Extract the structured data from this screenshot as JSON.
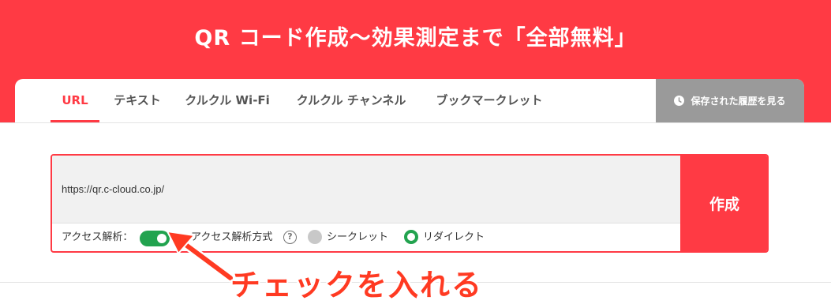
{
  "hero": {
    "title": "QR コード作成〜効果測定まで「全部無料」"
  },
  "tabs": [
    {
      "label": "URL",
      "active": true
    },
    {
      "label": "テキスト",
      "active": false
    },
    {
      "label": "クルクル Wi-Fi",
      "active": false
    },
    {
      "label": "クルクル チャンネル",
      "active": false
    },
    {
      "label": "ブックマークレット",
      "active": false
    }
  ],
  "history": {
    "label": "保存された履歴を見る",
    "icon": "clock-icon"
  },
  "form": {
    "url_value": "https://qr.c-cloud.co.jp/",
    "create_label": "作成",
    "access_analysis_label": "アクセス解析：",
    "access_analysis_enabled": true,
    "method_label": "アクセス解析方式",
    "help_glyph": "?",
    "options": [
      {
        "label": "シークレット",
        "selected": false
      },
      {
        "label": "リダイレクト",
        "selected": true
      }
    ]
  },
  "annotation": {
    "text": "チェックを入れる"
  },
  "colors": {
    "brand_red": "#ff3a44",
    "toggle_green": "#22a34f",
    "history_gray": "#9a9a9a",
    "annotation_red": "#ff3a22"
  }
}
